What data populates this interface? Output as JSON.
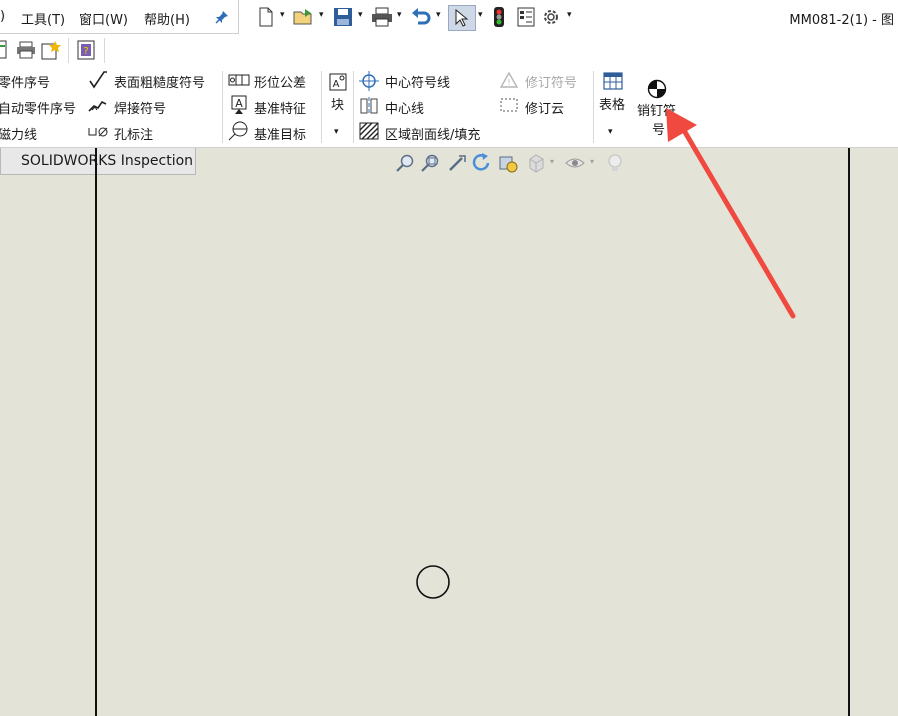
{
  "menu": {
    "items": [
      ")",
      "工具(T)",
      "窗口(W)",
      "帮助(H)"
    ],
    "pin_icon": "pin-icon"
  },
  "window_title": "MM081-2(1) - 图",
  "ribbon": {
    "col1": [
      "零件序号",
      "自动零件序号",
      "磁力线"
    ],
    "col2": [
      "表面粗糙度符号",
      "焊接符号",
      "孔标注"
    ],
    "col3": [
      "形位公差",
      "基准特征",
      "基准目标"
    ],
    "block": "块",
    "col4": [
      "中心符号线",
      "中心线",
      "区域剖面线/填充"
    ],
    "col5": [
      "修订符号",
      "修订云"
    ],
    "table": "表格",
    "pin_symbol": [
      "销钉符",
      "号"
    ]
  },
  "tabs": {
    "inspection": "SOLIDWORKS Inspection"
  },
  "colors": {
    "canvas": "#e4e3d8",
    "annotation_arrow": "#f04a40"
  }
}
